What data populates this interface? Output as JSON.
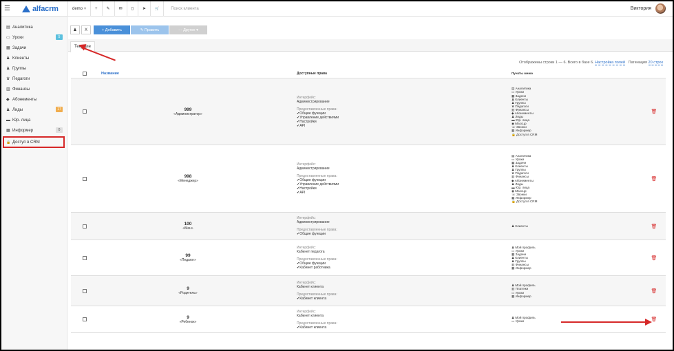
{
  "topbar": {
    "logo_text": "alfacrm",
    "account": "demo",
    "account_caret": "▾",
    "icons": [
      "plus-icon",
      "wrench-icon",
      "mail-icon",
      "phone-icon",
      "send-icon",
      "cart-icon"
    ],
    "icon_glyphs": [
      "+",
      "✎",
      "✉",
      "▯",
      "➤",
      "🛒"
    ],
    "search_placeholder": "Поиск клиента",
    "user_name": "Виктория"
  },
  "sidebar": {
    "items": [
      {
        "label": "Аналитика",
        "icon": "▤",
        "badge": ""
      },
      {
        "label": "Уроки",
        "icon": "▭",
        "badge": "5",
        "badge_color": "#5bc0de"
      },
      {
        "label": "Задачи",
        "icon": "▦",
        "badge": ""
      },
      {
        "label": "Клиенты",
        "icon": "♟",
        "badge": ""
      },
      {
        "label": "Группы",
        "icon": "♟",
        "badge": ""
      },
      {
        "label": "Педагоги",
        "icon": "♛",
        "badge": ""
      },
      {
        "label": "Финансы",
        "icon": "▥",
        "badge": ""
      },
      {
        "label": "Абонементы",
        "icon": "◆",
        "badge": ""
      },
      {
        "label": "Лиды",
        "icon": "♟",
        "badge": "17",
        "badge_color": "#f0ad4e"
      },
      {
        "label": "Юр. лица",
        "icon": "▬",
        "badge": ""
      },
      {
        "label": "Информер",
        "icon": "▦",
        "badge": "0",
        "badge_color": "#aaaaaa"
      },
      {
        "label": "Доступ в CRM",
        "icon": "🔒",
        "badge": ""
      }
    ]
  },
  "toolbar": {
    "user_icon": "♟",
    "close_label": "X",
    "add_label": "+ Добавить",
    "edit_label": "✎ Править",
    "more_label": "··· Другое ▾"
  },
  "tabs": [
    {
      "label": "Текущие"
    }
  ],
  "info": {
    "shown_text": "Отображены строки 1 — 6. Всего в базе 6.",
    "fields_link": "Настройка полей",
    "pagination_label": "Пагинация",
    "pagination_link": "20 строк"
  },
  "table": {
    "headers": {
      "name": "Название",
      "rights": "Доступные права",
      "menu": "Пункты меню"
    },
    "rows": [
      {
        "num": "999",
        "title": "«Администратор»",
        "interface_label": "Интерфейс:",
        "interface": "Администрирование",
        "rights_label": "Предоставленные права:",
        "rights": [
          "✔Общие функции",
          "✔Управление действиями",
          "✔Настройки",
          "✔API"
        ],
        "menu": [
          "▤ Аналитика",
          "▭ Уроки",
          "▦ Задачи",
          "♟ Клиенты",
          "♟ Группы",
          "♛ Педагоги",
          "▥ Финансы",
          "◆ Абонементы",
          "♟ Лиды",
          "▬ Юр. лица",
          "◉ Массцр",
          "☏ Звонки",
          "▦ Информер",
          "🔒 Доступ в CRM"
        ]
      },
      {
        "num": "998",
        "title": "«Менеджер»",
        "interface_label": "Интерфейс:",
        "interface": "Администрирование",
        "rights_label": "Предоставленные права:",
        "rights": [
          "✔Общие функции",
          "✔Управление действиями",
          "✔Настройки",
          "✔API"
        ],
        "menu": [
          "▤ Аналитика",
          "▭ Уроки",
          "▦ Задачи",
          "♟ Клиенты",
          "♟ Группы",
          "♛ Педагоги",
          "▥ Финансы",
          "◆ Абонементы",
          "♟ Лиды",
          "▬ Юр. лица",
          "◉ Массцр",
          "☏ Звонки",
          "▦ Информер",
          "🔒 Доступ в CRM"
        ]
      },
      {
        "num": "100",
        "title": "«Мен»",
        "interface_label": "Интерфейс:",
        "interface": "Администрирование",
        "rights_label": "Предоставленные права:",
        "rights": [
          "✔Общие функции"
        ],
        "menu": [
          "♟ Клиенты"
        ]
      },
      {
        "num": "99",
        "title": "«Педагог»",
        "interface_label": "Интерфейс:",
        "interface": "Кабинет педагога",
        "rights_label": "Предоставленные права:",
        "rights": [
          "✔Общие функции",
          "✔Кабинет работника"
        ],
        "menu": [
          "♟ Мой профиль",
          "▭ Уроки",
          "▦ Задачи",
          "♟ Клиенты",
          "♟ Группы",
          "▥ Финансы",
          "▦ Информер"
        ]
      },
      {
        "num": "9",
        "title": "«Родитель»",
        "interface_label": "Интерфейс:",
        "interface": "Кабинет клиента",
        "rights_label": "Предоставленные права:",
        "rights": [
          "✔Кабинет клиента"
        ],
        "menu": [
          "♟ Мой профиль",
          "▥ Платежи",
          "▭ Уроки",
          "▦ Информер"
        ]
      },
      {
        "num": "9",
        "title": "«Ребенок»",
        "interface_label": "Интерфейс:",
        "interface": "Кабинет клиента",
        "rights_label": "Предоставленные права:",
        "rights": [
          "✔Кабинет клиента"
        ],
        "menu": [
          "♟ Мой профиль",
          "▭ Уроки"
        ]
      }
    ],
    "delete_glyph": "🗑"
  },
  "colors": {
    "accent": "#2a6fc9",
    "danger": "#d62828",
    "annotation": "#d62828"
  }
}
